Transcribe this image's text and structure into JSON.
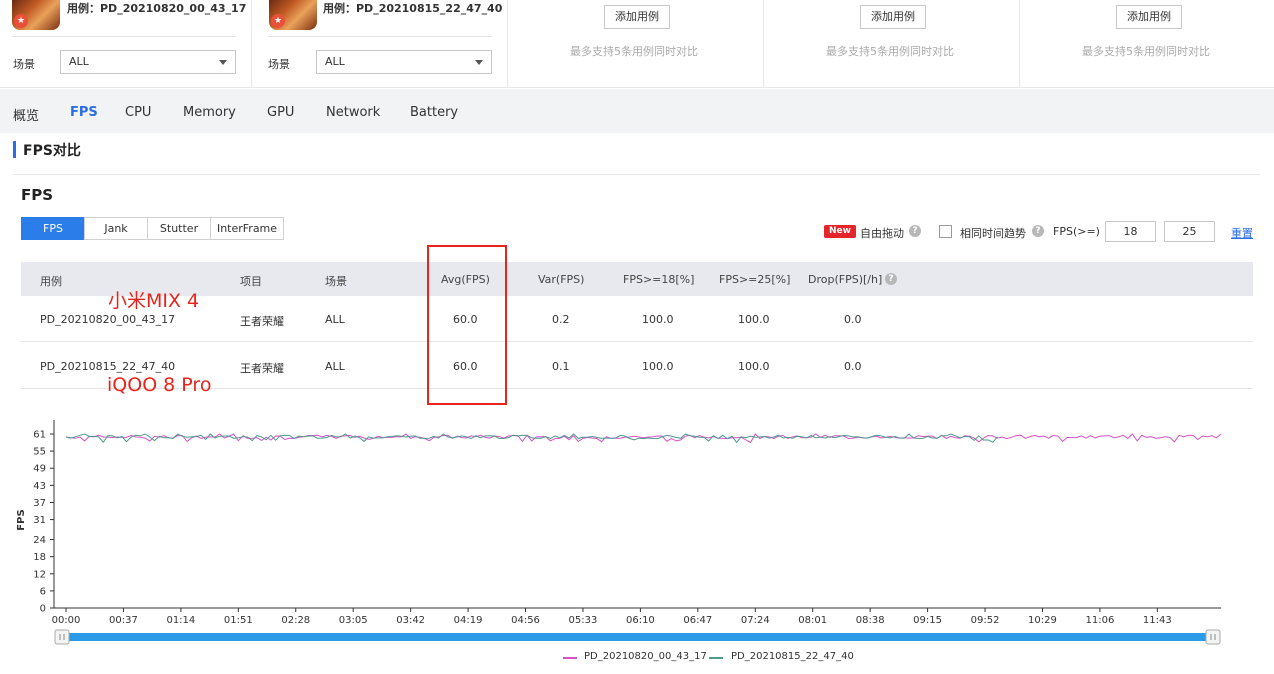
{
  "cases": [
    {
      "case_label": "用例：PD_20210820_00_43_17",
      "scene_label": "场景",
      "scene_value": "ALL"
    },
    {
      "case_label": "用例：PD_20210815_22_47_40",
      "scene_label": "场景",
      "scene_value": "ALL"
    }
  ],
  "empty_slots": [
    {
      "add_label": "添加用例",
      "hint": "最多支持5条用例同时对比"
    },
    {
      "add_label": "添加用例",
      "hint": "最多支持5条用例同时对比"
    },
    {
      "add_label": "添加用例",
      "hint": "最多支持5条用例同时对比"
    }
  ],
  "tabs": [
    "概览",
    "FPS",
    "CPU",
    "Memory",
    "GPU",
    "Network",
    "Battery"
  ],
  "active_tab": "FPS",
  "section_title": "FPS对比",
  "panel_title": "FPS",
  "subtabs": [
    "FPS",
    "Jank",
    "Stutter",
    "InterFrame"
  ],
  "active_subtab": "FPS",
  "controls": {
    "new_badge": "New",
    "free_drag": "自由拖动",
    "same_time_trend": "相同时间趋势",
    "fps_threshold_label": "FPS(>=)",
    "threshold_1": "18",
    "threshold_2": "25",
    "reset": "重置"
  },
  "table": {
    "headers": [
      "用例",
      "项目",
      "场景",
      "Avg(FPS)",
      "Var(FPS)",
      "FPS>=18[%]",
      "FPS>=25[%]",
      "Drop(FPS)[/h]"
    ],
    "rows": [
      [
        "PD_20210820_00_43_17",
        "王者荣耀",
        "ALL",
        "60.0",
        "0.2",
        "100.0",
        "100.0",
        "0.0"
      ],
      [
        "PD_20210815_22_47_40",
        "王者荣耀",
        "ALL",
        "60.0",
        "0.1",
        "100.0",
        "100.0",
        "0.0"
      ]
    ]
  },
  "annotations": {
    "device_1": "小米MIX 4",
    "device_2": "iQOO 8 Pro"
  },
  "colors": {
    "accent": "#2b6de5",
    "highlight_box": "#e8251c",
    "series_1": "#d652c8",
    "series_2": "#4e9a8e",
    "scrollbar": "#2b9be8"
  },
  "chart_data": {
    "type": "line",
    "ylabel": "FPS",
    "y_ticks": [
      0,
      6,
      12,
      18,
      24,
      31,
      37,
      43,
      49,
      55,
      61
    ],
    "ylim": [
      0,
      61
    ],
    "x_ticks": [
      "00:00",
      "00:37",
      "01:14",
      "01:51",
      "02:28",
      "03:05",
      "03:42",
      "04:19",
      "04:56",
      "05:33",
      "06:10",
      "06:47",
      "07:24",
      "08:01",
      "08:38",
      "09:15",
      "09:52",
      "10:29",
      "11:06",
      "11:43"
    ],
    "xlim": [
      "00:00",
      "12:24"
    ],
    "series": [
      {
        "name": "PD_20210820_00_43_17",
        "color": "#d652c8",
        "duration": "12:24",
        "mean": 60.0,
        "approx_range": [
          58,
          61
        ]
      },
      {
        "name": "PD_20210815_22_47_40",
        "color": "#4e9a8e",
        "duration": "10:00",
        "mean": 60.0,
        "approx_range": [
          58,
          61
        ]
      }
    ],
    "legend": "bottom-center",
    "grid": false
  }
}
